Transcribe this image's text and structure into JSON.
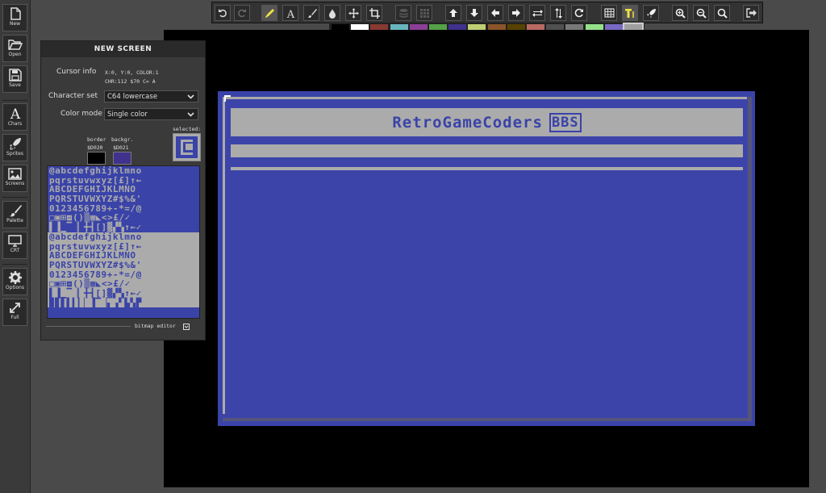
{
  "sidebar": {
    "items": [
      {
        "label": "New"
      },
      {
        "label": "Open"
      },
      {
        "label": "Save"
      },
      {
        "label": "Chars"
      },
      {
        "label": "Sprites"
      },
      {
        "label": "Screens"
      },
      {
        "label": "Palette"
      },
      {
        "label": "CRT"
      },
      {
        "label": "Options"
      },
      {
        "label": "Full"
      }
    ]
  },
  "toolbar": {
    "active_tool": "pencil-icon",
    "icons": [
      "undo-icon",
      "redo-icon",
      "pencil-icon",
      "text-icon",
      "brush-icon",
      "fill-icon",
      "move-icon",
      "crop-icon",
      "layers-icon",
      "grid-dots-icon",
      "arrow-up-icon",
      "arrow-down-icon",
      "arrow-left-icon",
      "arrow-right-icon",
      "flip-horizontal-icon",
      "flip-vertical-icon",
      "rotate-icon",
      "grid-icon",
      "text-mode-icon",
      "rocket-icon",
      "zoom-in-icon",
      "zoom-out-icon",
      "zoom-reset-icon",
      "exit-icon"
    ]
  },
  "palette": {
    "colors": [
      "#000000",
      "#ffffff",
      "#883932",
      "#67b6bd",
      "#8b3f96",
      "#55a049",
      "#40318d",
      "#bfce72",
      "#8b5429",
      "#574200",
      "#b86962",
      "#505050",
      "#787878",
      "#94e089",
      "#7869c4",
      "#9f9f9f"
    ],
    "selected_index": 15
  },
  "panel": {
    "title": "NEW SCREEN",
    "cursor_info_label": "Cursor info",
    "cursor_info_line1": "X:0, Y:0, COLOR:1",
    "cursor_info_line2": "CHR:112 $70 C= A",
    "charset_label": "Character set",
    "charset_value": "C64 lowercase",
    "colormode_label": "Color mode",
    "colormode_value": "Single color",
    "border_label": "border",
    "border_addr": "$D020",
    "border_color": "#000000",
    "backgr_label": "backgr.",
    "backgr_addr": "$D021",
    "backgr_color": "#40318d",
    "selected_label": "selected:",
    "bitmap_editor_label": "bitmap editor",
    "charset_rows": [
      "@abcdefghijklmno",
      "pqrstuvwxyz[£]↑←",
      " ABCDEFGHIJKLMNO",
      "PQRSTUVWXYZ#$%&'",
      "0123456789+-*=/@",
      "▢▣⊞⧈()▒▦◣<>£/✓",
      "▌▐▁▔▕▏╋┫[]▓▞▚↑←✓",
      "@abcdefghijklmno",
      "pqrstuvwxyz[£]↑←",
      " ABCDEFGHIJKLMNO",
      "PQRSTUVWXYZ#$%&'",
      "0123456789+-*=/@",
      "▢▣⊞⧈()▒▦◣<>£/✓",
      "▌▐▁▔▕▏╋┫[]▓▞▚↑←✓",
      "▉▊▋▌▍▎▏▐▔▕▖▗▘▙▚▛"
    ]
  },
  "screen": {
    "title_text": "RetroGameCoders",
    "badge_text": "BBS"
  }
}
